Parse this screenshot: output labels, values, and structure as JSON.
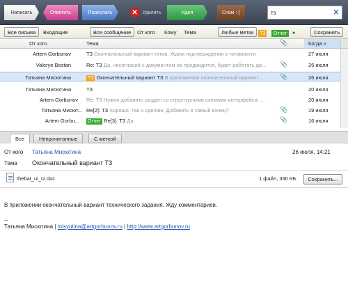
{
  "toolbar": {
    "compose": "Написать",
    "reply": "Ответить",
    "forward": "Переслать",
    "delete": "Удалить",
    "idea": "Идея",
    "spam": "Спам :-("
  },
  "search": {
    "value": "тз"
  },
  "filters": {
    "all_mail": "Все письма",
    "inbox": "Входящие",
    "all_messages": "Все сообщение",
    "from_whom": "От кого",
    "to_whom": "Кому",
    "topic": "Тема",
    "all_labels": "Любые метки",
    "tag_tz": "ТЗ",
    "tag_report": "Отчет",
    "more": "»",
    "more2": "»",
    "save": "Сохранить"
  },
  "columns": {
    "from": "От кого",
    "subject": "Тема",
    "when": "Когда",
    "sort": "»"
  },
  "messages": [
    {
      "from": "Artem Gorbunov",
      "prefix": "",
      "subject": "ТЗ",
      "snippet": "Окончательный вариант готов. Ждем подтверждения о готовности",
      "tag": "",
      "tag_color": "",
      "date": "27 июля",
      "attachment": false
    },
    {
      "from": "Valerye Bostan",
      "prefix": "Re: ",
      "subject": "ТЗ",
      "snippet": "Да, несогласий с документом не предвидится, будет работать да...",
      "tag": "",
      "tag_color": "",
      "date": "26 июля",
      "attachment": true
    },
    {
      "from": "Татьяна Мисютина",
      "prefix": "",
      "subject": "Окончательный вариант ТЗ",
      "snippet": "В приложении окончательный вариант...",
      "tag": "ТЗ",
      "tag_color": "#f2a51d",
      "date": "26 июля",
      "attachment": true
    },
    {
      "from": "Татьяна Мисютина",
      "prefix": "",
      "subject": "ТЗ",
      "snippet": "",
      "tag": "",
      "tag_color": "",
      "date": "20 июля",
      "attachment": false
    },
    {
      "from": "Artem Gorbunov",
      "prefix": "Re: ",
      "subject": "ТЗ",
      "snippet": "Нужно добавить раздел со структурными схемами интерфейса. ...",
      "tag": "",
      "tag_color": "",
      "date": "20 июля",
      "attachment": false
    },
    {
      "from": "Татьяна Мисют...",
      "prefix": "Re[2]: ",
      "subject": "ТЗ",
      "snippet": "Хорошо, так и сделаю. Добавить в самый конец?",
      "tag": "",
      "tag_color": "",
      "date": "19 июля",
      "attachment": true
    },
    {
      "from": "Artem Gorbu...",
      "prefix": "Re[3]: ",
      "subject": "ТЗ",
      "snippet": "Да.",
      "tag": "Отчет",
      "tag_color": "#3aa935",
      "date": "16 июля",
      "attachment": true
    }
  ],
  "tabs": {
    "all": "Все",
    "unread": "Непрочитанные",
    "labeled": "С меткой"
  },
  "preview": {
    "from_label": "От кого",
    "from_name": "Татьяна Мисютина",
    "date": "26 июля, 14:21",
    "topic_label": "Тема",
    "topic": "Окончательный вариант ТЗ",
    "attachment_name": "thebat_ui_tz.doc",
    "attachment_info": "1 файл, 330 КБ",
    "save_as": "Сохранить...",
    "body": "В приложении окончательный вариант технического задания. Жду комментариев.",
    "sig_sep": "--",
    "sig_name": "Татьяна Мисютина | ",
    "sig_email": "misyutina@artgorbunov.ru",
    "sig_pipe": " | ",
    "sig_url": "http://www.artgorbunov.ru"
  }
}
